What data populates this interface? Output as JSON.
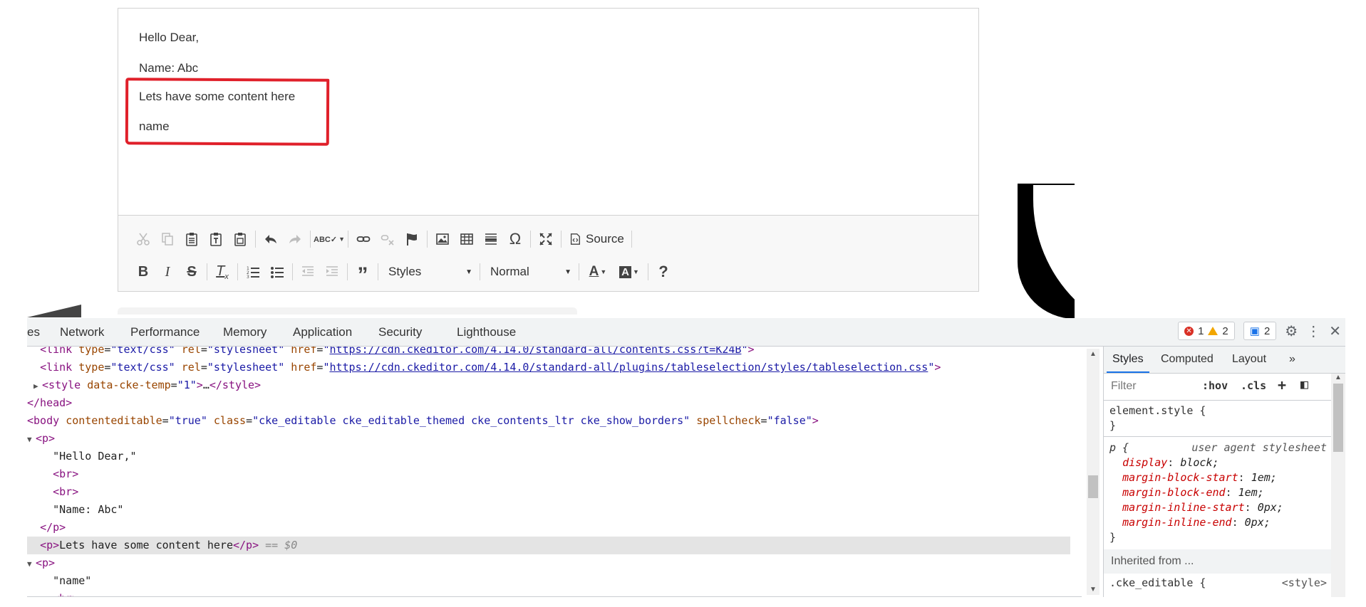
{
  "editor": {
    "lines": [
      "Hello Dear,",
      "Name: Abc",
      "Lets have some content here",
      "name"
    ],
    "toolbar": {
      "source_label": "Source",
      "styles_label": "Styles",
      "format_label": "Normal"
    }
  },
  "devtools": {
    "tabs": [
      "es",
      "Network",
      "Performance",
      "Memory",
      "Application",
      "Security",
      "Lighthouse"
    ],
    "issues": {
      "errors": "1",
      "warnings": "2",
      "messages": "2"
    },
    "dom": {
      "line1_href": "https://cdn.ckeditor.com/4.14.0/standard-all/contents.css?t=K24B",
      "line2_href": "https://cdn.ckeditor.com/4.14.0/standard-all/plugins/tableselection/styles/tableselection.css",
      "style_attr_val": "1",
      "body_class": "cke_editable cke_editable_themed cke_contents_ltr cke_show_borders",
      "text_hello": "\"Hello Dear,\"",
      "text_name_abc": "\"Name: Abc\"",
      "text_selected": "Lets have some content here",
      "selected_marker": "== $0",
      "text_name": "\"name\""
    },
    "styles": {
      "tabs": [
        "Styles",
        "Computed",
        "Layout",
        "»"
      ],
      "filter_placeholder": "Filter",
      "hov": ":hov",
      "cls": ".cls",
      "element_style": "element.style {",
      "close_brace": "}",
      "p_selector": "p {",
      "ua_label": "user agent stylesheet",
      "props": [
        {
          "name": "display",
          "value": "block;"
        },
        {
          "name": "margin-block-start",
          "value": "1em;"
        },
        {
          "name": "margin-block-end",
          "value": "1em;"
        },
        {
          "name": "margin-inline-start",
          "value": "0px;"
        },
        {
          "name": "margin-inline-end",
          "value": "0px;"
        }
      ],
      "inherited_label": "Inherited from ...",
      "cke_selector": ".cke_editable {",
      "cke_source": "<style>"
    }
  }
}
